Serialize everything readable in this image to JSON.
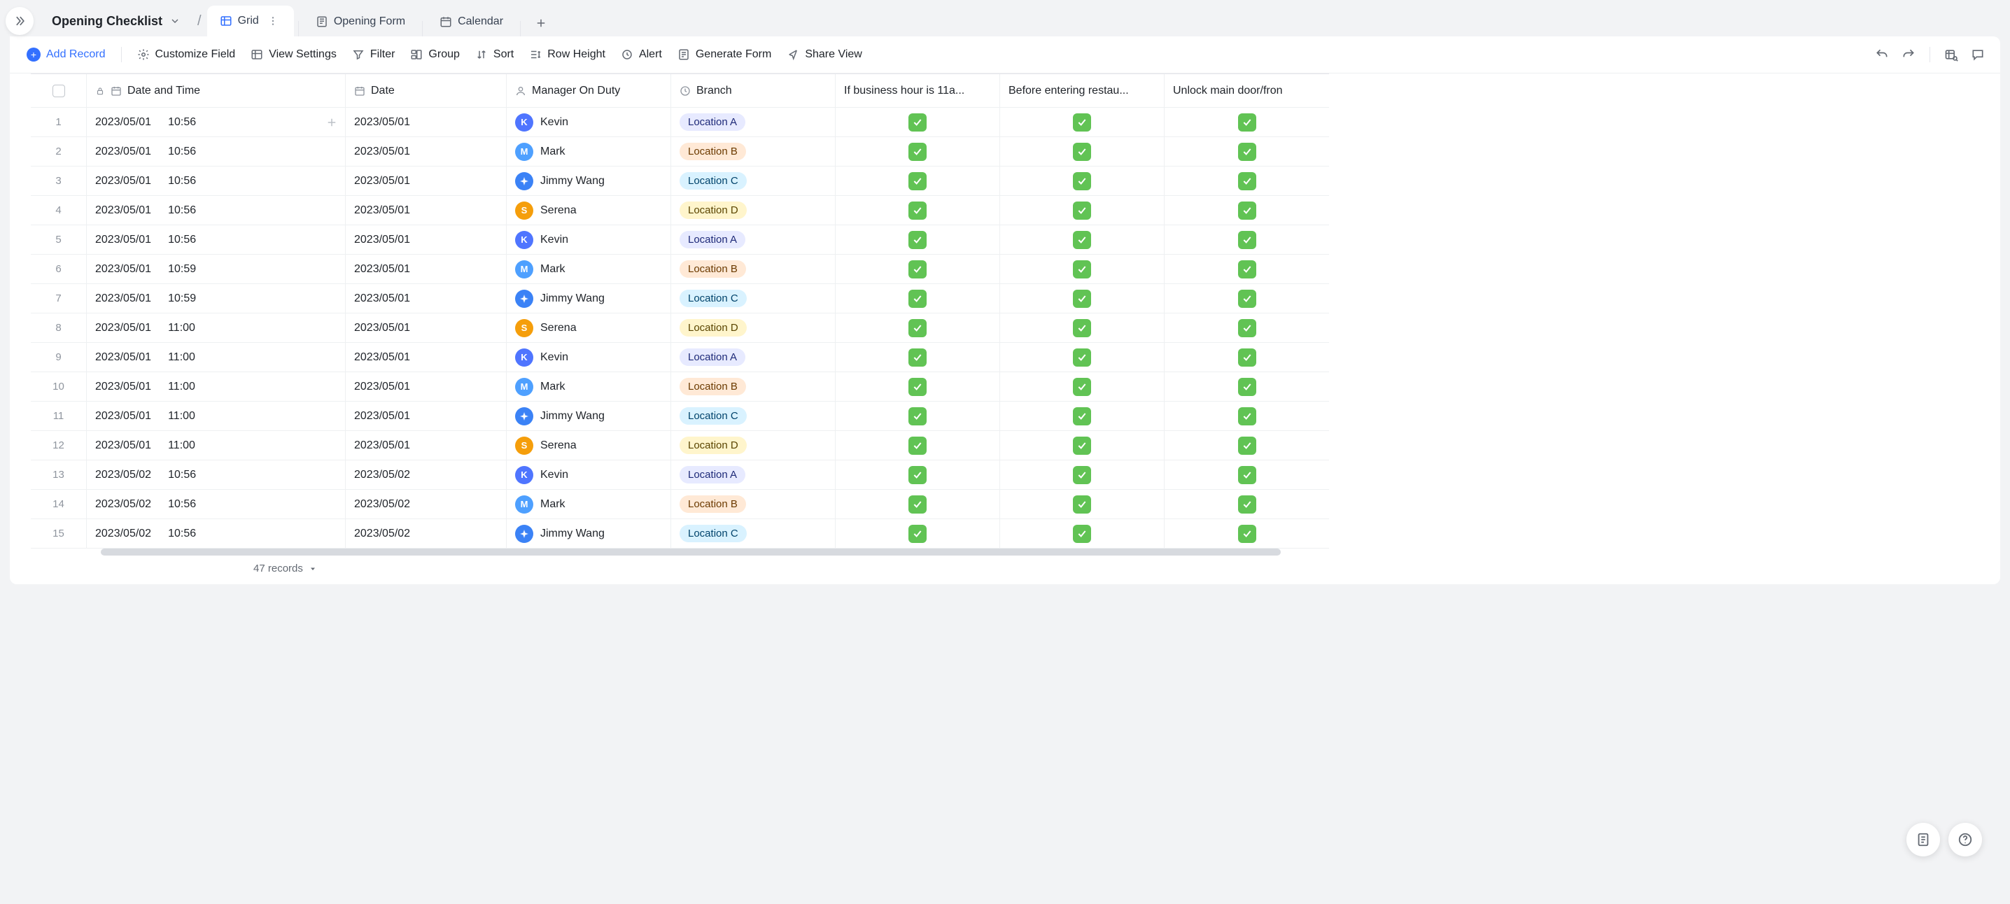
{
  "breadcrumb": {
    "title": "Opening Checklist"
  },
  "tabs": {
    "grid": {
      "label": "Grid"
    },
    "form": {
      "label": "Opening Form"
    },
    "cal": {
      "label": "Calendar"
    }
  },
  "toolbar": {
    "add_record": "Add Record",
    "customize": "Customize Field",
    "view_settings": "View Settings",
    "filter": "Filter",
    "group": "Group",
    "sort": "Sort",
    "row_height": "Row Height",
    "alert": "Alert",
    "generate_form": "Generate Form",
    "share_view": "Share View"
  },
  "columns": {
    "datetime": "Date and Time",
    "date": "Date",
    "manager": "Manager On Duty",
    "branch": "Branch",
    "q1": "If business hour is 11a...",
    "q2": "Before entering restau...",
    "q3": "Unlock main door/fron"
  },
  "managers": {
    "kevin": {
      "name": "Kevin",
      "initial": "K",
      "color": "#4f75ff"
    },
    "mark": {
      "name": "Mark",
      "initial": "M",
      "color": "#4ea0ff"
    },
    "jimmy": {
      "name": "Jimmy Wang",
      "initial": "",
      "color": "#3b82f6",
      "compass": true
    },
    "serena": {
      "name": "Serena",
      "initial": "S",
      "color": "#f59e0b"
    }
  },
  "branches": {
    "A": {
      "label": "Location A",
      "bg": "#e7eaff",
      "fg": "#1e2a78"
    },
    "B": {
      "label": "Location B",
      "bg": "#ffe9d6",
      "fg": "#6b3a00"
    },
    "C": {
      "label": "Location C",
      "bg": "#d9f2ff",
      "fg": "#00436b"
    },
    "D": {
      "label": "Location D",
      "bg": "#fff5cc",
      "fg": "#5a4500"
    }
  },
  "rows": [
    {
      "n": "1",
      "date": "2023/05/01",
      "time": "10:56",
      "date2": "2023/05/01",
      "mgr": "kevin",
      "br": "A"
    },
    {
      "n": "2",
      "date": "2023/05/01",
      "time": "10:56",
      "date2": "2023/05/01",
      "mgr": "mark",
      "br": "B"
    },
    {
      "n": "3",
      "date": "2023/05/01",
      "time": "10:56",
      "date2": "2023/05/01",
      "mgr": "jimmy",
      "br": "C"
    },
    {
      "n": "4",
      "date": "2023/05/01",
      "time": "10:56",
      "date2": "2023/05/01",
      "mgr": "serena",
      "br": "D"
    },
    {
      "n": "5",
      "date": "2023/05/01",
      "time": "10:56",
      "date2": "2023/05/01",
      "mgr": "kevin",
      "br": "A"
    },
    {
      "n": "6",
      "date": "2023/05/01",
      "time": "10:59",
      "date2": "2023/05/01",
      "mgr": "mark",
      "br": "B"
    },
    {
      "n": "7",
      "date": "2023/05/01",
      "time": "10:59",
      "date2": "2023/05/01",
      "mgr": "jimmy",
      "br": "C"
    },
    {
      "n": "8",
      "date": "2023/05/01",
      "time": "11:00",
      "date2": "2023/05/01",
      "mgr": "serena",
      "br": "D"
    },
    {
      "n": "9",
      "date": "2023/05/01",
      "time": "11:00",
      "date2": "2023/05/01",
      "mgr": "kevin",
      "br": "A"
    },
    {
      "n": "10",
      "date": "2023/05/01",
      "time": "11:00",
      "date2": "2023/05/01",
      "mgr": "mark",
      "br": "B"
    },
    {
      "n": "11",
      "date": "2023/05/01",
      "time": "11:00",
      "date2": "2023/05/01",
      "mgr": "jimmy",
      "br": "C"
    },
    {
      "n": "12",
      "date": "2023/05/01",
      "time": "11:00",
      "date2": "2023/05/01",
      "mgr": "serena",
      "br": "D"
    },
    {
      "n": "13",
      "date": "2023/05/02",
      "time": "10:56",
      "date2": "2023/05/02",
      "mgr": "kevin",
      "br": "A"
    },
    {
      "n": "14",
      "date": "2023/05/02",
      "time": "10:56",
      "date2": "2023/05/02",
      "mgr": "mark",
      "br": "B"
    },
    {
      "n": "15",
      "date": "2023/05/02",
      "time": "10:56",
      "date2": "2023/05/02",
      "mgr": "jimmy",
      "br": "C"
    }
  ],
  "footer": {
    "count_label": "47 records"
  }
}
